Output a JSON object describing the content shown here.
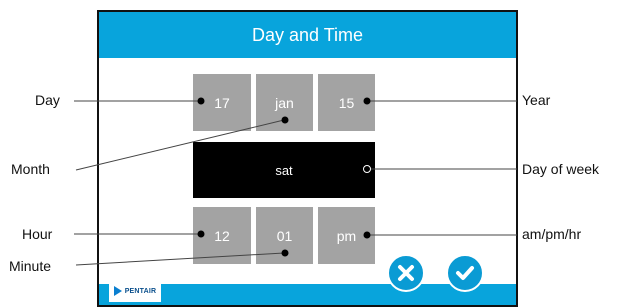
{
  "screen": {
    "title": "Day and Time",
    "brand": "PENTAIR"
  },
  "fields": {
    "day": "17",
    "month": "jan",
    "year": "15",
    "day_of_week": "sat",
    "hour": "12",
    "minute": "01",
    "ampm": "pm"
  },
  "callouts": {
    "day": "Day",
    "month": "Month",
    "year": "Year",
    "day_of_week": "Day of week",
    "hour": "Hour",
    "minute": "Minute",
    "ampm": "am/pm/hr"
  },
  "buttons": {
    "cancel_icon": "close-icon",
    "confirm_icon": "checkmark-icon"
  },
  "colors": {
    "accent": "#08a4dc",
    "cell": "#a3a3a3",
    "selected_cell": "#000000"
  }
}
